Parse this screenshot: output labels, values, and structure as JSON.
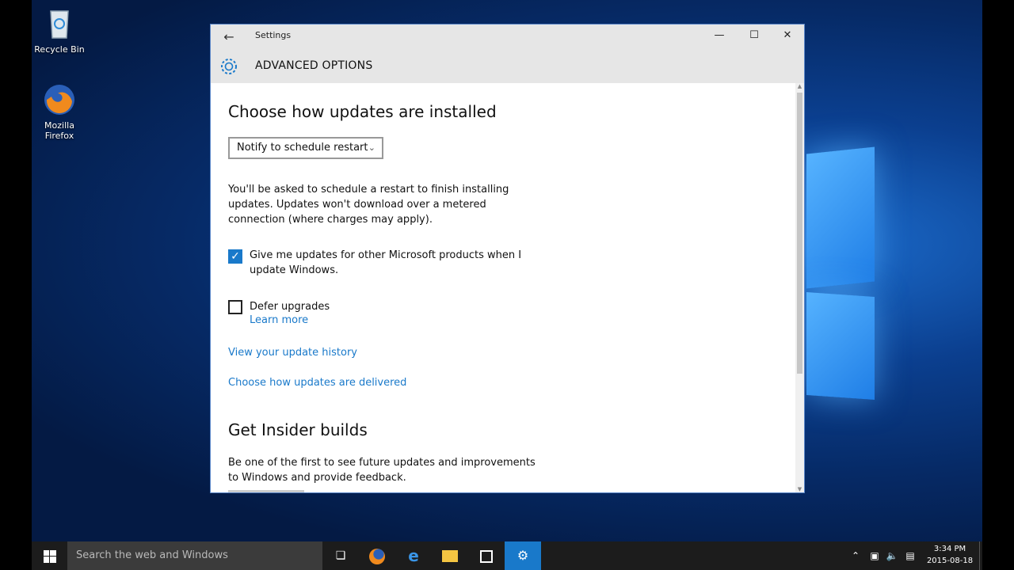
{
  "desktop": {
    "icons": [
      {
        "label": "Recycle Bin"
      },
      {
        "label": "Mozilla Firefox"
      }
    ]
  },
  "window": {
    "title": "Settings",
    "page_heading": "ADVANCED OPTIONS",
    "controls": {
      "minimize": "—",
      "maximize": "☐",
      "close": "✕"
    }
  },
  "section_install": {
    "heading": "Choose how updates are installed",
    "dropdown_value": "Notify to schedule restart",
    "description": "You'll be asked to schedule a restart to finish installing updates. Updates won't download over a metered connection (where charges may apply)."
  },
  "options": {
    "other_products": {
      "checked": true,
      "label": "Give me updates for other Microsoft products when I update Windows."
    },
    "defer_upgrades": {
      "checked": false,
      "label": "Defer upgrades",
      "learn_more": "Learn more"
    }
  },
  "links": {
    "update_history": "View your update history",
    "delivery": "Choose how updates are delivered"
  },
  "section_insider": {
    "heading": "Get Insider builds",
    "description": "Be one of the first to see future updates and improvements to Windows and provide feedback."
  },
  "taskbar": {
    "search_placeholder": "Search the web and Windows",
    "time": "3:34 PM",
    "date": "2015-08-18"
  },
  "colors": {
    "accent": "#1979ca",
    "titlebar": "#e6e6e6"
  }
}
